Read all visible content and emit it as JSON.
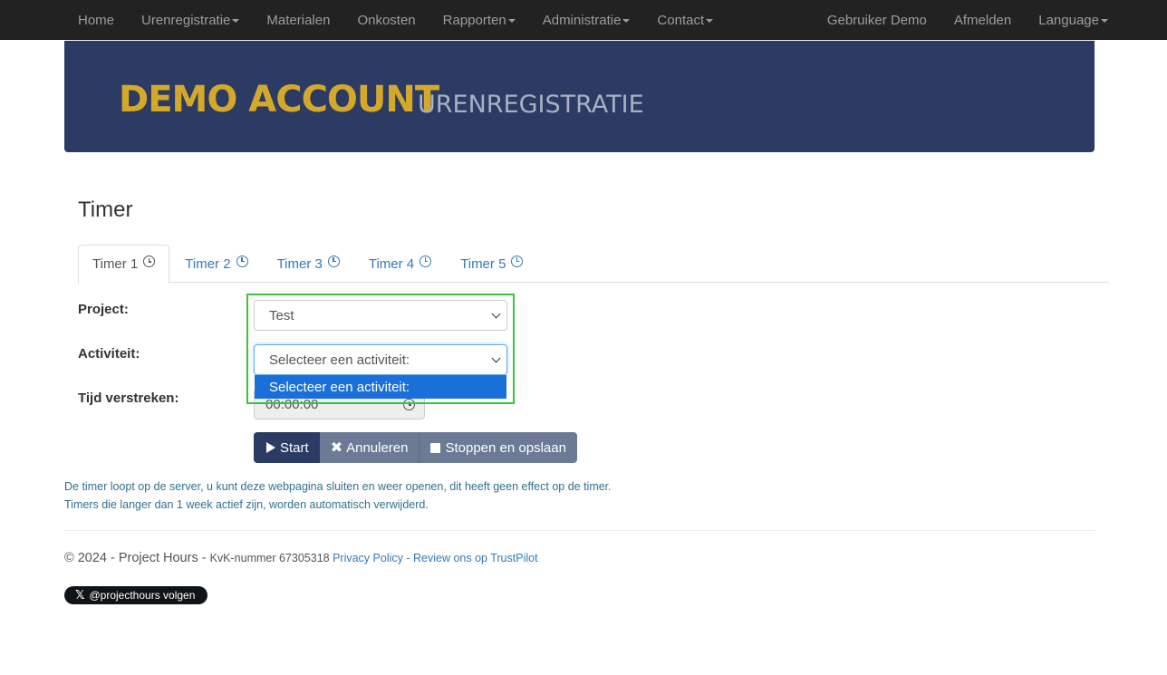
{
  "nav": {
    "left": [
      {
        "label": "Home",
        "caret": false
      },
      {
        "label": "Urenregistratie",
        "caret": true
      },
      {
        "label": "Materialen",
        "caret": false
      },
      {
        "label": "Onkosten",
        "caret": false
      },
      {
        "label": "Rapporten",
        "caret": true
      },
      {
        "label": "Administratie",
        "caret": true
      },
      {
        "label": "Contact",
        "caret": true
      }
    ],
    "right": [
      {
        "label": "Gebruiker Demo",
        "caret": false
      },
      {
        "label": "Afmelden",
        "caret": false
      },
      {
        "label": "Language",
        "caret": true
      }
    ]
  },
  "banner": {
    "title": "DEMO ACCOUNT",
    "subtitle": "URENREGISTRATIE"
  },
  "page": {
    "title": "Timer"
  },
  "tabs": [
    {
      "label": "Timer 1",
      "active": true
    },
    {
      "label": "Timer 2",
      "active": false
    },
    {
      "label": "Timer 3",
      "active": false
    },
    {
      "label": "Timer 4",
      "active": false
    },
    {
      "label": "Timer 5",
      "active": false
    }
  ],
  "form": {
    "project_label": "Project:",
    "project_value": "Test",
    "activity_label": "Activiteit:",
    "activity_value": "Selecteer een activiteit:",
    "activity_option": "Selecteer een activiteit:",
    "time_label": "Tijd verstreken:",
    "time_value": "00:00:00"
  },
  "buttons": {
    "start": "Start",
    "cancel": "Annuleren",
    "stop": "Stoppen en opslaan"
  },
  "info": {
    "line1": "De timer loopt op de server, u kunt deze webpagina sluiten en weer openen, dit heeft geen effect op de timer.",
    "line2": "Timers die langer dan 1 week actief zijn, worden automatisch verwijderd."
  },
  "footer": {
    "copyright": "© 2024 - Project Hours - ",
    "kvk": "KvK-nummer 67305318 ",
    "privacy": "Privacy Policy",
    "sep": " - ",
    "review": "Review ons op TrustPilot",
    "follow": "@projecthours volgen"
  },
  "colors": {
    "navbar": "#222222",
    "banner": "#2b3b63",
    "banner_title": "#d4a92a",
    "highlight": "#3cc23c",
    "option_selected": "#1a6fd8"
  }
}
